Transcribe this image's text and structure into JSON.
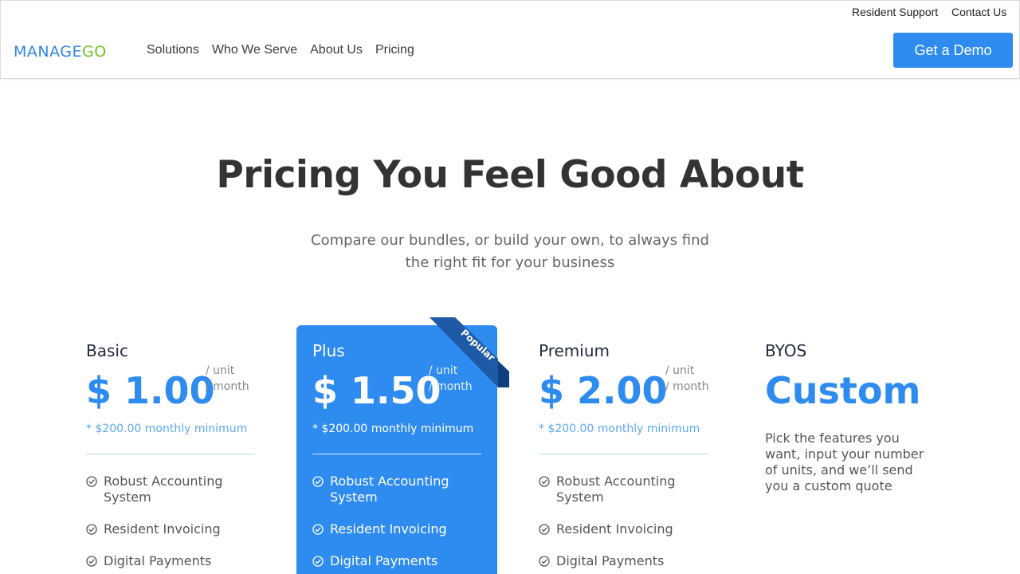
{
  "topbar": {
    "resident_support": "Resident Support",
    "contact_us": "Contact Us"
  },
  "header": {
    "logo_part1": "MANAGE",
    "logo_part2": "GO",
    "nav": [
      "Solutions",
      "Who We Serve",
      "About Us",
      "Pricing"
    ],
    "demo_button": "Get a Demo"
  },
  "colors": {
    "brand_blue": "#2e8bf0",
    "brand_green": "#6cc427",
    "ribbon": "#1f5aa6"
  },
  "hero": {
    "title": "Pricing You Feel Good About",
    "subtitle_line1": "Compare our bundles, or build your own, to always find",
    "subtitle_line2": "the right fit for your business"
  },
  "plans": [
    {
      "name": "Basic",
      "price": "$ 1.00",
      "unit": "/ unit",
      "period": "/ month",
      "minimum": "* $200.00 monthly minimum",
      "features": [
        "Robust Accounting System",
        "Resident Invoicing",
        "Digital Payments"
      ]
    },
    {
      "name": "Plus",
      "price": "$ 1.50",
      "unit": "/ unit",
      "period": "/ month",
      "minimum": "* $200.00 monthly minimum",
      "badge": "Popular",
      "features": [
        "Robust Accounting System",
        "Resident Invoicing",
        "Digital Payments"
      ]
    },
    {
      "name": "Premium",
      "price": "$ 2.00",
      "unit": "/ unit",
      "period": "/ month",
      "minimum": "* $200.00 monthly minimum",
      "features": [
        "Robust Accounting System",
        "Resident Invoicing",
        "Digital Payments"
      ]
    }
  ],
  "byos": {
    "name": "BYOS",
    "price": "Custom",
    "description": "Pick the features you want, input your number of units, and we’ll send you a custom quote"
  }
}
